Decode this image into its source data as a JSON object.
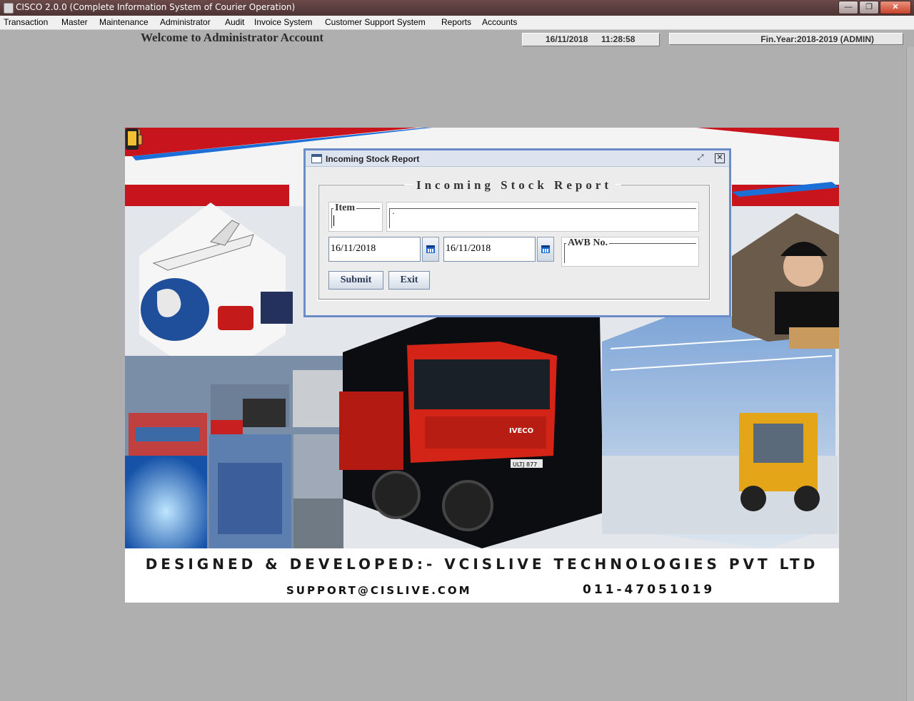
{
  "window": {
    "title": "CISCO 2.0.0 (Complete Information System of Courier Operation)",
    "minimize_icon": "minimize-icon",
    "maximize_icon": "maximize-icon",
    "close_icon": "close-icon"
  },
  "menu": [
    {
      "label": "Transaction"
    },
    {
      "label": "Master"
    },
    {
      "label": "Maintenance"
    },
    {
      "label": "Administrator"
    },
    {
      "label": "Audit"
    },
    {
      "label": "Invoice System"
    },
    {
      "label": "Customer Support System"
    },
    {
      "label": "Reports"
    },
    {
      "label": "Accounts"
    }
  ],
  "header": {
    "welcome": "Welcome to Administrator Account",
    "date": "16/11/2018",
    "time": "11:28:58",
    "fin_year": "Fin.Year:2018-2019  (ADMIN)"
  },
  "banner": {
    "credit": "DESIGNED & DEVELOPED:- VCISLIVE TECHNOLOGIES PVT LTD",
    "support_email": "SUPPORT@CISLIVE.COM",
    "phone": "011-47051019",
    "truck_brand": "IVECO",
    "truck_plate": "ULTJ 877",
    "colors": {
      "red": "#c8141c",
      "blue": "#1d6fd8",
      "truck_red": "#d42418"
    }
  },
  "dialog": {
    "title": "Incoming Stock Report",
    "heading": "Incoming Stock Report",
    "item_label": "Item",
    "item_value": "",
    "item_desc_value": ".",
    "from_date": "16/11/2018",
    "to_date": "16/11/2018",
    "awb_label": "AWB No.",
    "submit_label": "Submit",
    "exit_label": "Exit"
  }
}
